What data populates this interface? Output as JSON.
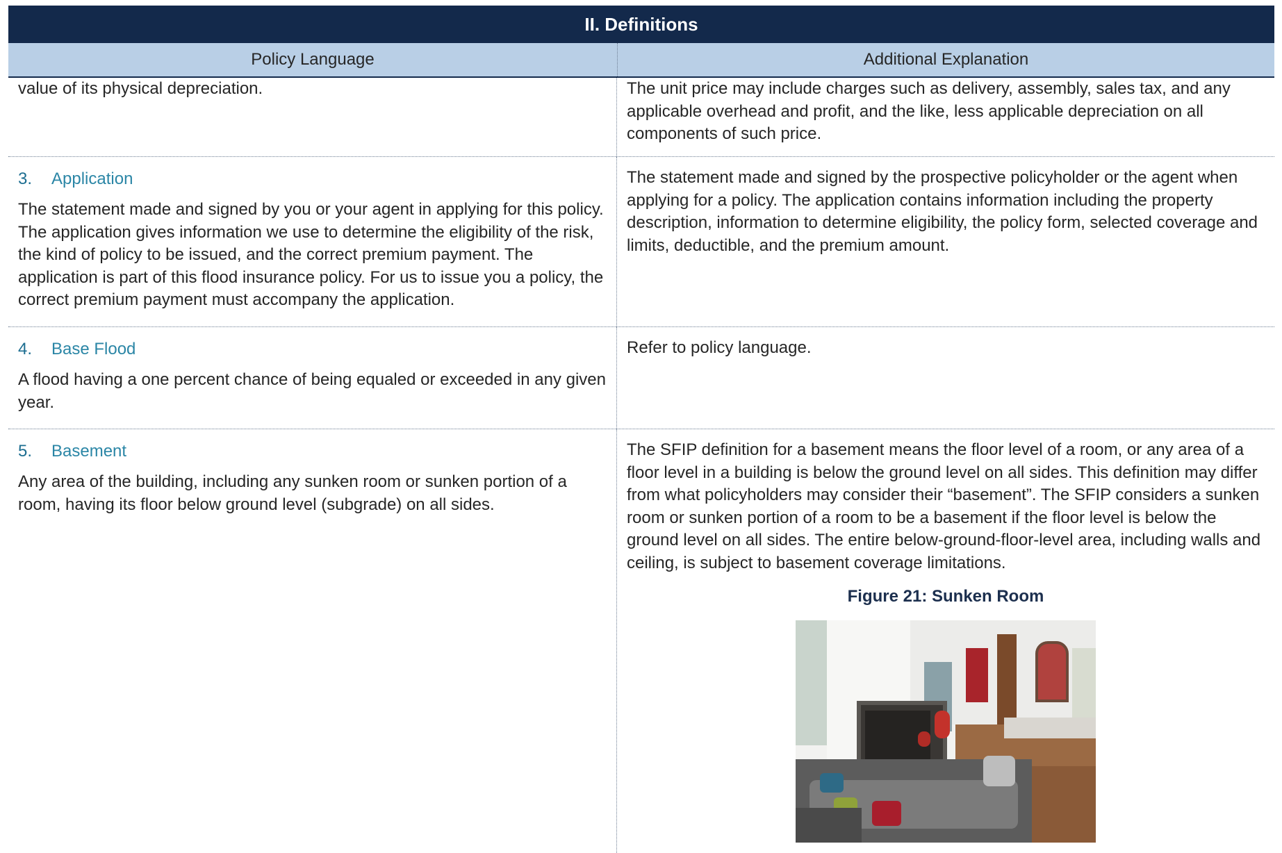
{
  "section_title": "II. Definitions",
  "columns": {
    "left": "Policy Language",
    "right": "Additional Explanation"
  },
  "rows": [
    {
      "left_text": "value of its physical depreciation.",
      "right_text": "The unit price may include charges such as delivery, assembly, sales tax, and any applicable overhead and profit, and the like, less applicable depreciation on all components of such price."
    },
    {
      "number": "3.",
      "term": "Application",
      "left_text": "The statement made and signed by you or your agent in applying for this policy. The application gives information we use to determine the eligibility of the risk, the kind of policy to be issued, and the correct premium payment. The application is part of this flood insurance policy. For us to issue you a policy, the correct premium payment must accompany the application.",
      "right_text": "The statement made and signed by the prospective policyholder or the agent when applying for a policy. The application contains information including the property description, information to determine eligibility, the policy form, selected coverage and limits, deductible, and the premium amount."
    },
    {
      "number": "4.",
      "term": "Base Flood",
      "left_text": "A flood having a one percent chance of being equaled or exceeded in any given year.",
      "right_text": "Refer to policy language."
    },
    {
      "number": "5.",
      "term": "Basement",
      "left_text": "Any area of the building, including any sunken room or sunken portion of a room, having its floor below ground level (subgrade) on all sides.",
      "right_text": "The SFIP definition for a basement means the floor level of a room, or any area of a floor level in a building is below the ground level on all sides. This definition may differ from what policyholders may consider their “basement”. The SFIP considers a sunken room or sunken portion of a room to be a basement if the floor level is below the ground level on all sides. The entire below-ground-floor-level area, including walls and ceiling, is subject to basement coverage limitations.",
      "figure_caption": "Figure 21: Sunken Room"
    }
  ]
}
